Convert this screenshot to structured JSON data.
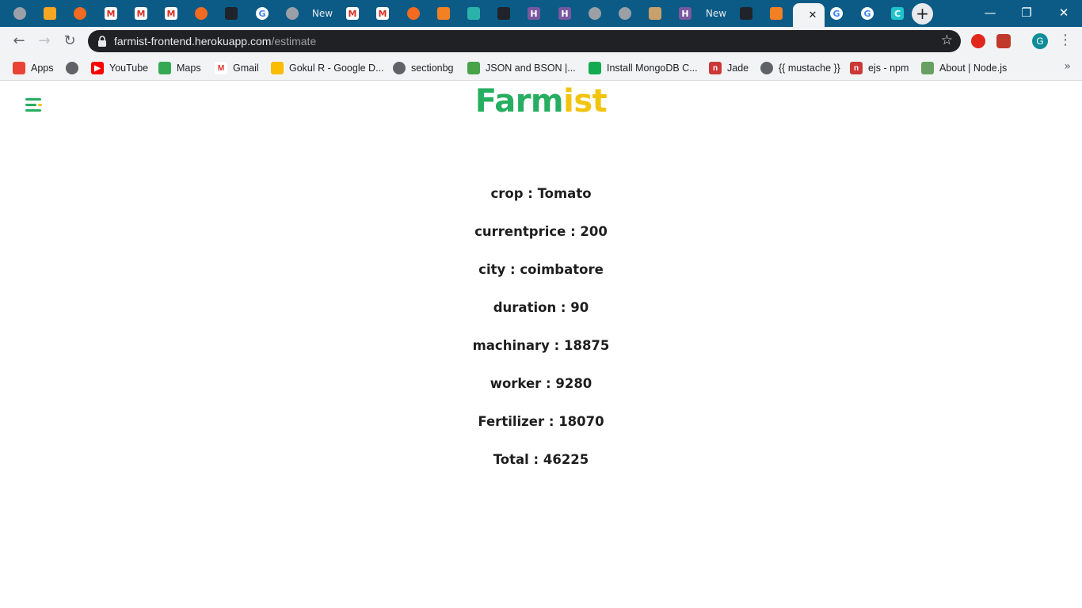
{
  "browser": {
    "tabs": [
      {
        "icon": "globe-icon",
        "color": "#9aa0a6",
        "glyph": "",
        "text": ""
      },
      {
        "icon": "firebase-icon",
        "color": "#f5a623",
        "glyph": "",
        "text": ""
      },
      {
        "icon": "orange-sun-icon",
        "color": "#f26b21",
        "glyph": "",
        "text": ""
      },
      {
        "icon": "gmail-icon",
        "color": "#d93025",
        "glyph": "M",
        "text": ""
      },
      {
        "icon": "gmail-icon",
        "color": "#d93025",
        "glyph": "M",
        "text": ""
      },
      {
        "icon": "gmail-icon",
        "color": "#d93025",
        "glyph": "M",
        "text": ""
      },
      {
        "icon": "orange-sun-icon",
        "color": "#f26b21",
        "glyph": "",
        "text": ""
      },
      {
        "icon": "react-icon",
        "color": "#20232a",
        "glyph": "",
        "text": ""
      },
      {
        "icon": "google-icon",
        "color": "#4285f4",
        "glyph": "G",
        "text": ""
      },
      {
        "icon": "globe-icon",
        "color": "#9aa0a6",
        "glyph": "",
        "text": ""
      },
      {
        "icon": "",
        "color": "",
        "glyph": "",
        "text": "New"
      },
      {
        "icon": "gmail-icon",
        "color": "#d93025",
        "glyph": "M",
        "text": ""
      },
      {
        "icon": "gmail-icon",
        "color": "#d93025",
        "glyph": "M",
        "text": ""
      },
      {
        "icon": "orange-sun-icon",
        "color": "#f26b21",
        "glyph": "",
        "text": ""
      },
      {
        "icon": "stackoverflow-icon",
        "color": "#f48024",
        "glyph": "",
        "text": ""
      },
      {
        "icon": "diamond-icon",
        "color": "#2bb3ab",
        "glyph": "",
        "text": ""
      },
      {
        "icon": "react-icon",
        "color": "#20232a",
        "glyph": "",
        "text": ""
      },
      {
        "icon": "heroku-icon",
        "color": "#79589f",
        "glyph": "H",
        "text": ""
      },
      {
        "icon": "heroku-icon",
        "color": "#79589f",
        "glyph": "H",
        "text": ""
      },
      {
        "icon": "globe-icon",
        "color": "#9aa0a6",
        "glyph": "",
        "text": ""
      },
      {
        "icon": "globe-icon",
        "color": "#9aa0a6",
        "glyph": "",
        "text": ""
      },
      {
        "icon": "monkey-icon",
        "color": "#c8a06a",
        "glyph": "",
        "text": ""
      },
      {
        "icon": "heroku-icon",
        "color": "#79589f",
        "glyph": "H",
        "text": ""
      },
      {
        "icon": "",
        "color": "",
        "glyph": "",
        "text": "New"
      },
      {
        "icon": "react-icon",
        "color": "#20232a",
        "glyph": "",
        "text": ""
      },
      {
        "icon": "stackoverflow-icon",
        "color": "#f48024",
        "glyph": "",
        "text": ""
      },
      {
        "icon": "active-tab-icon",
        "color": "#f1c40f",
        "glyph": "",
        "text": ""
      },
      {
        "icon": "google-icon",
        "color": "#4285f4",
        "glyph": "G",
        "text": ""
      },
      {
        "icon": "google-icon",
        "color": "#4285f4",
        "glyph": "G",
        "text": ""
      },
      {
        "icon": "canva-icon",
        "color": "#20c4cb",
        "glyph": "C",
        "text": ""
      }
    ],
    "url_host": "farmist-frontend.herokuapp.com",
    "url_path": "/estimate",
    "profile_initial": "G",
    "bookmarks": [
      {
        "icon": "apps-grid-icon",
        "label": "Apps",
        "color": "#ea4335",
        "glyph": ""
      },
      {
        "icon": "globe-icon",
        "label": "",
        "color": "#5f6368",
        "glyph": ""
      },
      {
        "icon": "youtube-icon",
        "label": "YouTube",
        "color": "#ff0000",
        "glyph": "▶"
      },
      {
        "icon": "maps-icon",
        "label": "Maps",
        "color": "#34a853",
        "glyph": ""
      },
      {
        "icon": "gmail-icon",
        "label": "Gmail",
        "color": "#d93025",
        "glyph": "M"
      },
      {
        "icon": "google-drive-icon",
        "label": "Gokul R - Google D...",
        "color": "#fbbc04",
        "glyph": ""
      },
      {
        "icon": "globe-icon",
        "label": "sectionbg",
        "color": "#5f6368",
        "glyph": ""
      },
      {
        "icon": "mongodb-leaf-icon",
        "label": "JSON and BSON |...",
        "color": "#47a248",
        "glyph": ""
      },
      {
        "icon": "mongodb-icon",
        "label": "Install MongoDB C...",
        "color": "#13aa52",
        "glyph": ""
      },
      {
        "icon": "npm-icon",
        "label": "Jade",
        "color": "#cb3837",
        "glyph": "n"
      },
      {
        "icon": "globe-icon",
        "label": "{{ mustache }}",
        "color": "#5f6368",
        "glyph": ""
      },
      {
        "icon": "npm-icon",
        "label": "ejs - npm",
        "color": "#cb3837",
        "glyph": "n"
      },
      {
        "icon": "nodejs-icon",
        "label": "About | Node.js",
        "color": "#68a063",
        "glyph": ""
      }
    ]
  },
  "app": {
    "brand_green": "Farm",
    "brand_yellow": "ist",
    "colors": {
      "green": "#27ae60",
      "yellow": "#f1c40f"
    },
    "estimate": [
      "crop : Tomato",
      "currentprice : 200",
      "city : coimbatore",
      "duration : 90",
      "machinary : 18875",
      "worker : 9280",
      "Fertilizer : 18070",
      "Total : 46225"
    ]
  }
}
